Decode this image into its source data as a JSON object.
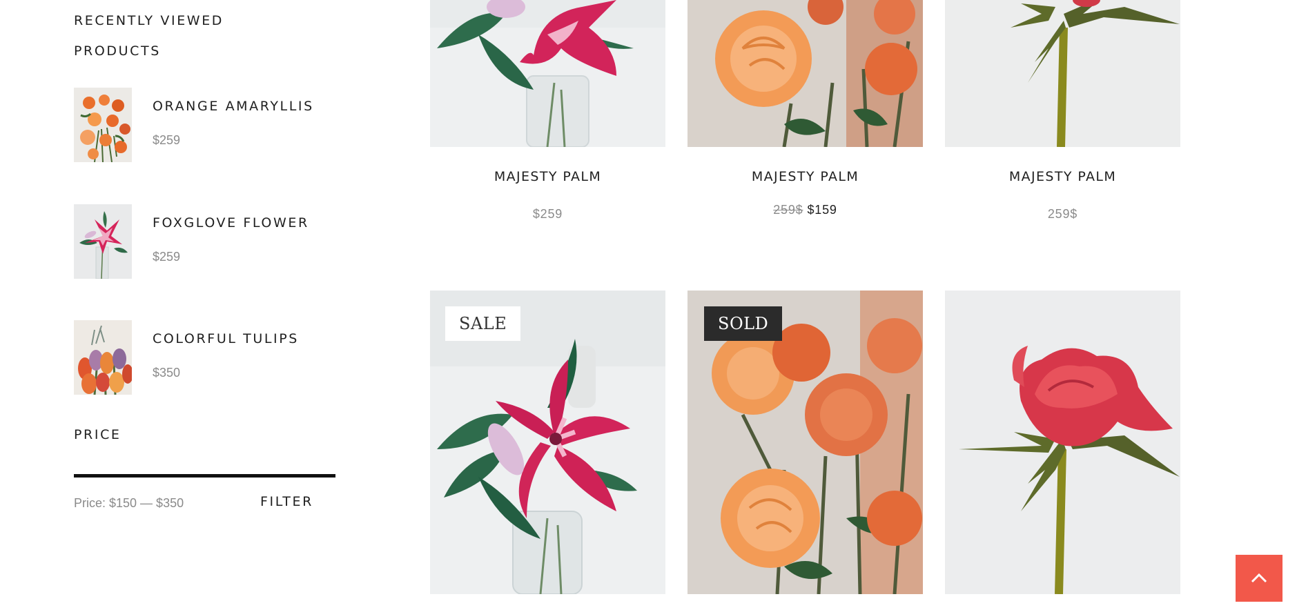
{
  "sidebar": {
    "recent_title": "RECENTLY VIEWED PRODUCTS",
    "recent_items": [
      {
        "name": "ORANGE AMARYLLIS",
        "price": "$259",
        "image": "orange-roses-bouquet"
      },
      {
        "name": "FOXGLOVE FLOWER",
        "price": "$259",
        "image": "pink-lily-vase"
      },
      {
        "name": "COLORFUL TULIPS",
        "price": "$350",
        "image": "tulips-bouquet"
      }
    ],
    "price_title": "PRICE",
    "price_label": "Price: $150 — $350",
    "filter_label": "FILTER"
  },
  "products": [
    {
      "name": "MAJESTY PALM",
      "price": "$259",
      "image": "pink-lily"
    },
    {
      "name": "MAJESTY PALM",
      "old_price": "259$",
      "new_price": "$159",
      "image": "orange-roses"
    },
    {
      "name": "MAJESTY PALM",
      "price": "259$",
      "image": "red-rose-stem"
    },
    {
      "badge": "SALE",
      "image": "pink-lily"
    },
    {
      "badge": "SOLD",
      "image": "orange-roses"
    },
    {
      "image": "red-rose"
    }
  ],
  "colors": {
    "accent": "#f2584a",
    "text": "#1f1f1f",
    "muted": "#8a8a8a",
    "sold_badge": "#2b2b2b"
  },
  "icons": {
    "back_to_top": "chevron-up-icon"
  }
}
